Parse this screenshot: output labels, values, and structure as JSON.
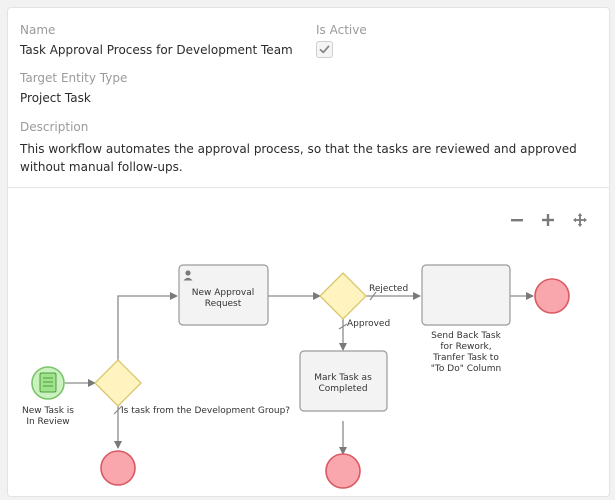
{
  "form": {
    "name_label": "Name",
    "name_value": "Task Approval Process for Development Team",
    "is_active_label": "Is Active",
    "is_active_checked": true,
    "entity_label": "Target Entity Type",
    "entity_value": "Project Task",
    "description_label": "Description",
    "description_value": "This workflow automates the approval process, so that the tasks are reviewed and approved without manual follow-ups."
  },
  "zoom": {
    "zoom_out_icon": "minus-icon",
    "zoom_in_icon": "plus-icon",
    "pan_icon": "move-icon"
  },
  "diagram": {
    "start_event": [
      "New Task is",
      "In Review"
    ],
    "gateway_1_label": "Is task from the Development Group?",
    "task_approval": [
      "New Approval",
      "Request"
    ],
    "gateway_2_rejected": "Rejected",
    "gateway_2_approved": "Approved",
    "task_complete": [
      "Mark Task as",
      "Completed"
    ],
    "task_send_back": [
      "Send Back Task",
      "for Rework,",
      "Tranfer Task to",
      "\"To Do\" Column"
    ]
  },
  "colors": {
    "start_fill": "#c9f2bf",
    "start_stroke": "#7ac46b",
    "end_fill": "#f9a7ad",
    "end_stroke": "#d95a63",
    "gateway_fill": "#fff4bf",
    "gateway_stroke": "#d8c56c",
    "task_fill": "#f3f3f3",
    "task_stroke": "#9a9a9a"
  }
}
